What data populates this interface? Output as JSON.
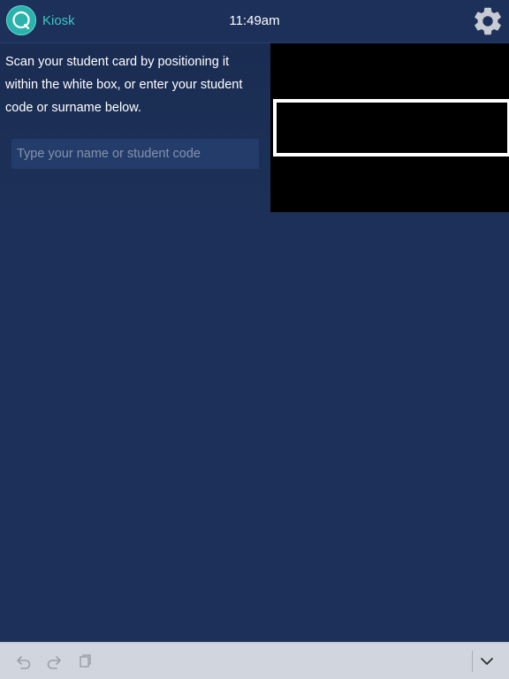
{
  "header": {
    "app_name": "Kiosk",
    "time": "11:49am",
    "logo_icon": "kiosk-logo-icon",
    "settings_icon": "gear-icon"
  },
  "scan": {
    "instructions": "Scan your student card by positioning it within the white box, or enter your student code or surname below.",
    "search_placeholder": "Type your name or student code",
    "search_value": ""
  },
  "toolbar": {
    "undo_icon": "undo-icon",
    "redo_icon": "redo-icon",
    "paste_icon": "clipboard-icon",
    "dismiss_icon": "chevron-down-icon"
  },
  "colors": {
    "background": "#1c3059",
    "accent": "#3cc6c0",
    "logo": "#2ab3ad",
    "camera": "#000000",
    "toolbar": "#d1d5de"
  }
}
